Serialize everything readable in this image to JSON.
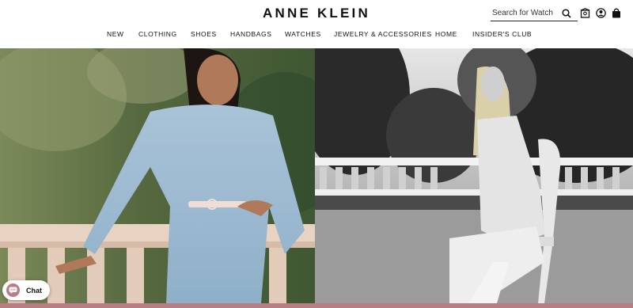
{
  "brand": {
    "logo_text": "ANNE KLEIN"
  },
  "search": {
    "placeholder": "Search for Watch"
  },
  "header_icons": [
    "search-icon",
    "store-locator-icon",
    "account-icon",
    "shopping-bag-icon"
  ],
  "nav": {
    "items": [
      {
        "label": "NEW"
      },
      {
        "label": "CLOTHING"
      },
      {
        "label": "SHOES"
      },
      {
        "label": "HANDBAGS"
      },
      {
        "label": "WATCHES"
      },
      {
        "label": "JEWELRY & ACCESSORIES"
      },
      {
        "label": "HOME"
      },
      {
        "label": "INSIDER'S CLUB"
      }
    ]
  },
  "chat": {
    "label": "Chat"
  },
  "colors": {
    "accent": "#b97d83",
    "text": "#111111",
    "background": "#ffffff"
  }
}
